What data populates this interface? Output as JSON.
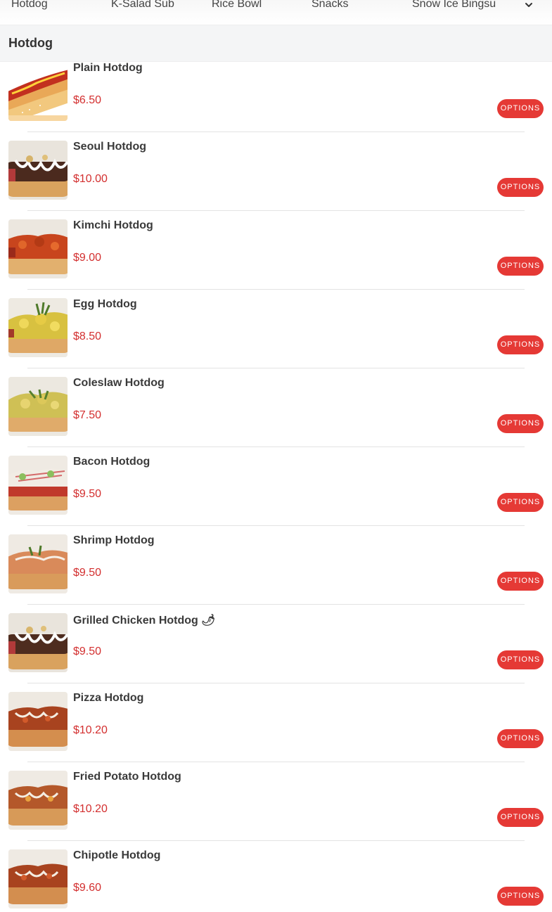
{
  "categories": [
    "Hotdog",
    "K-Salad Sub",
    "Rice Bowl",
    "Snacks",
    "Snow Ice Bingsu"
  ],
  "section_title": "Hotdog",
  "items": [
    {
      "name": "Plain Hotdog",
      "price": "$6.50",
      "button": "OPTIONS"
    },
    {
      "name": "Seoul Hotdog",
      "price": "$10.00",
      "button": "OPTIONS"
    },
    {
      "name": "Kimchi Hotdog",
      "price": "$9.00",
      "button": "OPTIONS"
    },
    {
      "name": "Egg Hotdog",
      "price": "$8.50",
      "button": "OPTIONS"
    },
    {
      "name": "Coleslaw Hotdog",
      "price": "$7.50",
      "button": "OPTIONS"
    },
    {
      "name": "Bacon Hotdog",
      "price": "$9.50",
      "button": "OPTIONS"
    },
    {
      "name": "Shrimp Hotdog",
      "price": "$9.50",
      "button": "OPTIONS"
    },
    {
      "name": "Grilled Chicken Hotdog 🌶",
      "price": "$9.50",
      "button": "OPTIONS"
    },
    {
      "name": "Pizza Hotdog",
      "price": "$10.20",
      "button": "OPTIONS"
    },
    {
      "name": "Fried Potato Hotdog",
      "price": "$10.20",
      "button": "OPTIONS"
    },
    {
      "name": "Chipotle Hotdog",
      "price": "$9.60",
      "button": "OPTIONS"
    }
  ],
  "colors": {
    "accent": "#e53935",
    "price": "#d32f2f"
  }
}
